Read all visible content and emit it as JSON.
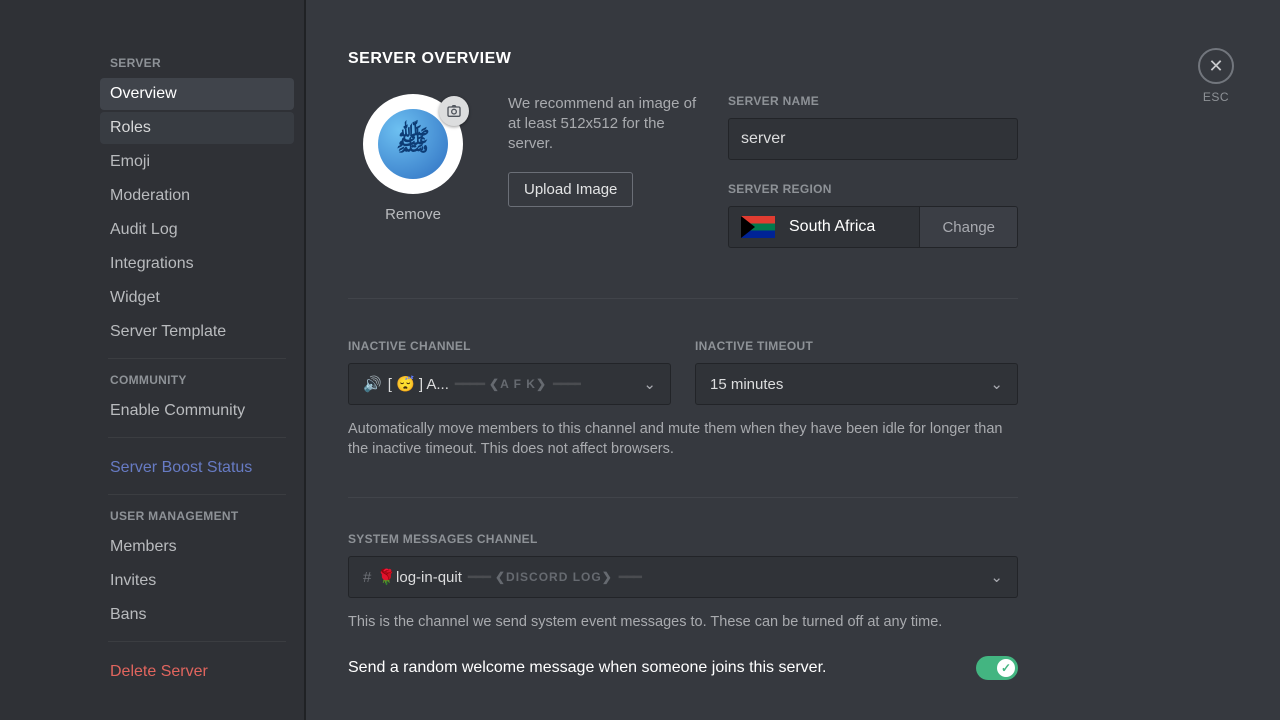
{
  "sidebar": {
    "section_server": "SERVER",
    "section_community": "COMMUNITY",
    "section_user_management": "USER MANAGEMENT",
    "items_server": [
      {
        "label": "Overview",
        "selected": true
      },
      {
        "label": "Roles",
        "hovered": true
      },
      {
        "label": "Emoji"
      },
      {
        "label": "Moderation"
      },
      {
        "label": "Audit Log"
      },
      {
        "label": "Integrations"
      },
      {
        "label": "Widget"
      },
      {
        "label": "Server Template"
      }
    ],
    "items_community": [
      {
        "label": "Enable Community"
      }
    ],
    "boost": "Server Boost Status",
    "items_user_mgmt": [
      {
        "label": "Members"
      },
      {
        "label": "Invites"
      },
      {
        "label": "Bans"
      }
    ],
    "delete": "Delete Server"
  },
  "close": {
    "esc": "ESC"
  },
  "overview": {
    "title": "SERVER OVERVIEW",
    "remove_label": "Remove",
    "recommend_text": "We recommend an image of at least 512x512 for the server.",
    "upload_button": "Upload Image",
    "server_name_label": "SERVER NAME",
    "server_name_value": "server",
    "server_region_label": "SERVER REGION",
    "server_region_value": "South Africa",
    "change_button": "Change"
  },
  "inactive": {
    "channel_label": "INACTIVE CHANNEL",
    "channel_text": "[ 😴 ] A...",
    "afk_tag": "A F K",
    "timeout_label": "INACTIVE TIMEOUT",
    "timeout_value": "15 minutes",
    "helper": "Automatically move members to this channel and mute them when they have been idle for longer than the inactive timeout. This does not affect browsers."
  },
  "system": {
    "label": "SYSTEM MESSAGES CHANNEL",
    "channel_text": "🌹log-in-quit",
    "category_tag": "DISCORD LOG",
    "helper": "This is the channel we send system event messages to. These can be turned off at any time.",
    "welcome_toggle_label": "Send a random welcome message when someone joins this server."
  }
}
